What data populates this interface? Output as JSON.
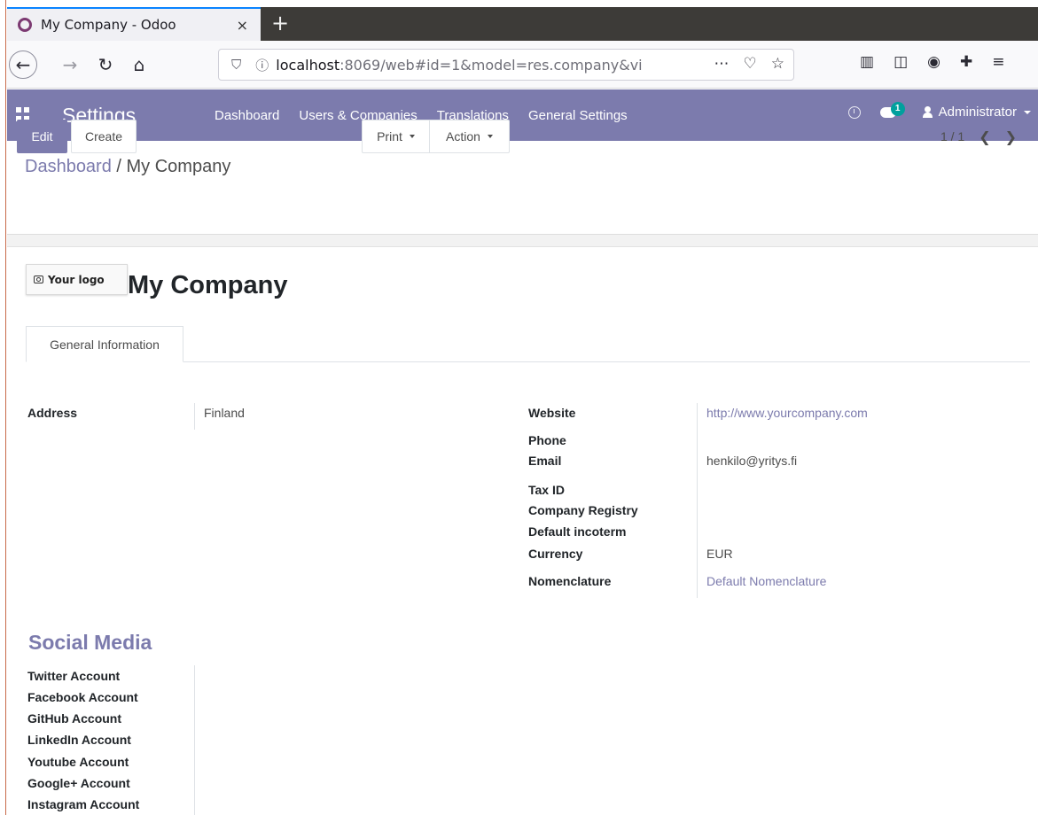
{
  "browser": {
    "tab_title": "My Company - Odoo",
    "tab_close": "×",
    "new_tab": "+",
    "url_host": "localhost",
    "url_rest": ":8069/web#id=1&model=res.company&vi"
  },
  "odoo_nav": {
    "brand": "Settings",
    "menu": [
      "Dashboard",
      "Users & Companies",
      "Translations",
      "General Settings"
    ],
    "chat_count": "1",
    "user": "Administrator"
  },
  "control_panel": {
    "breadcrumb_parent": "Dashboard",
    "breadcrumb_sep": " / ",
    "breadcrumb_current": "My Company",
    "edit_label": "Edit",
    "create_label": "Create",
    "print_label": "Print",
    "action_label": "Action",
    "pager": "1 / 1"
  },
  "form": {
    "logo_label": "Your logo",
    "company_name": "My Company",
    "tab_label": "General Information",
    "address_label": "Address",
    "address_value": "Finland",
    "website_label": "Website",
    "website_value": "http://www.yourcompany.com",
    "phone_label": "Phone",
    "email_label": "Email",
    "email_value": "henkilo@yritys.fi",
    "tax_id_label": "Tax ID",
    "company_registry_label": "Company Registry",
    "incoterm_label": "Default incoterm",
    "currency_label": "Currency",
    "currency_value": "EUR",
    "nomenclature_label": "Nomenclature",
    "nomenclature_value": "Default Nomenclature"
  },
  "social": {
    "title": "Social Media",
    "accounts": [
      "Twitter Account",
      "Facebook Account",
      "GitHub Account",
      "LinkedIn Account",
      "Youtube Account",
      "Google+ Account",
      "Instagram Account"
    ]
  }
}
